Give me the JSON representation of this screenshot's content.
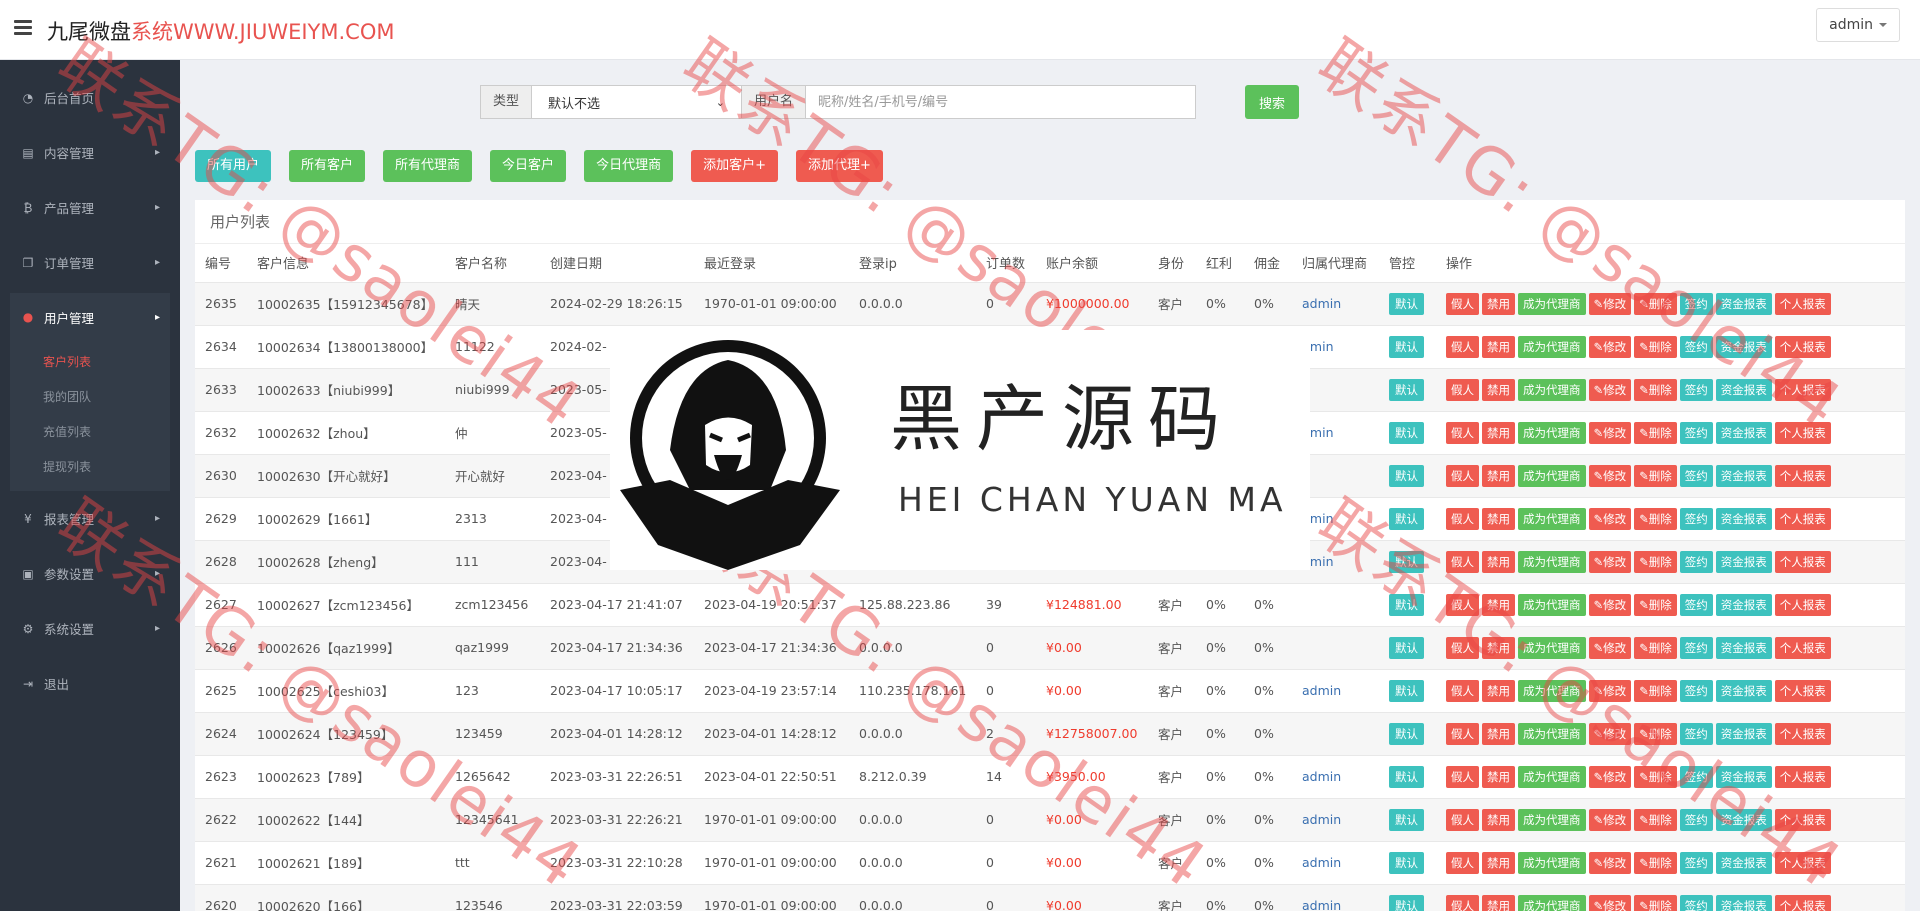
{
  "app": {
    "brand_main": "九尾微盘",
    "brand_accent": "系统WWW.JIUWEIYM.COM",
    "admin_label": "admin"
  },
  "sidebar": {
    "items": [
      {
        "label": "后台首页",
        "icon": "dashboard-icon"
      },
      {
        "label": "内容管理",
        "icon": "book-icon"
      },
      {
        "label": "产品管理",
        "icon": "bitcoin-icon"
      },
      {
        "label": "订单管理",
        "icon": "copy-icon"
      },
      {
        "label": "用户管理",
        "icon": "user-icon"
      },
      {
        "label": "报表管理",
        "icon": "yen-icon"
      },
      {
        "label": "参数设置",
        "icon": "clone-icon"
      },
      {
        "label": "系统设置",
        "icon": "gears-icon"
      },
      {
        "label": "退出",
        "icon": "sign-out-icon"
      }
    ],
    "sub_items": [
      "客户列表",
      "我的团队",
      "充值列表",
      "提现列表"
    ]
  },
  "filter": {
    "type_label": "类型",
    "type_value": "默认不选",
    "user_label": "用户名",
    "user_placeholder": "昵称/姓名/手机号/编号",
    "search_label": "搜索"
  },
  "actions": [
    "所有用户",
    "所有客户",
    "所有代理商",
    "今日客户",
    "今日代理商",
    "添加客户+",
    "添加代理+"
  ],
  "panel_title": "用户列表",
  "table": {
    "headers": [
      "编号",
      "客户信息",
      "客户名称",
      "创建日期",
      "最近登录",
      "登录ip",
      "订单数",
      "账户余额",
      "身份",
      "红利",
      "佣金",
      "归属代理商",
      "管控",
      "操作"
    ],
    "mgmt_label": "默认",
    "ops": [
      "假人",
      "禁用",
      "成为代理商",
      "✎修改",
      "✎删除",
      "签约",
      "资金报表",
      "个人报表"
    ],
    "rows": [
      [
        "2635",
        "10002635【15912345678】",
        "晴天",
        "2024-02-29 18:26:15",
        "1970-01-01 09:00:00",
        "0.0.0.0",
        "0",
        "¥1000000.00",
        "客户",
        "0%",
        "0%",
        "admin"
      ],
      [
        "2634",
        "10002634【13800138000】",
        "11122",
        "2024-02-",
        "",
        "",
        "",
        "",
        "",
        "",
        "",
        "dmin"
      ],
      [
        "2633",
        "10002633【niubi999】",
        "niubi999",
        "2023-05-",
        "",
        "",
        "",
        "",
        "",
        "",
        "",
        ""
      ],
      [
        "2632",
        "10002632【zhou】",
        "仲",
        "2023-05-",
        "",
        "",
        "",
        "",
        "",
        "",
        "",
        "dmin"
      ],
      [
        "2630",
        "10002630【开心就好】",
        "开心就好",
        "2023-04-",
        "",
        "",
        "",
        "",
        "",
        "",
        "",
        ""
      ],
      [
        "2629",
        "10002629【1661】",
        "2313",
        "2023-04-",
        "",
        "",
        "",
        "",
        "",
        "",
        "",
        "dmin"
      ],
      [
        "2628",
        "10002628【zheng】",
        "111",
        "2023-04-",
        "",
        "",
        "",
        "",
        "",
        "",
        "",
        "dmin"
      ],
      [
        "2627",
        "10002627【zcm123456】",
        "zcm123456",
        "2023-04-17 21:41:07",
        "2023-04-19 20:51:37",
        "125.88.223.86",
        "39",
        "¥124881.00",
        "客户",
        "0%",
        "0%",
        ""
      ],
      [
        "2626",
        "10002626【qaz1999】",
        "qaz1999",
        "2023-04-17 21:34:36",
        "2023-04-17 21:34:36",
        "0.0.0.0",
        "0",
        "¥0.00",
        "客户",
        "0%",
        "0%",
        ""
      ],
      [
        "2625",
        "10002625【ceshi03】",
        "123",
        "2023-04-17 10:05:17",
        "2023-04-19 23:57:14",
        "110.235.178.161",
        "0",
        "¥0.00",
        "客户",
        "0%",
        "0%",
        "admin"
      ],
      [
        "2624",
        "10002624【123459】",
        "123459",
        "2023-04-01 14:28:12",
        "2023-04-01 14:28:12",
        "0.0.0.0",
        "2",
        "¥12758007.00",
        "客户",
        "0%",
        "0%",
        ""
      ],
      [
        "2623",
        "10002623【789】",
        "1265642",
        "2023-03-31 22:26:51",
        "2023-04-01 22:50:51",
        "8.212.0.39",
        "14",
        "¥3950.00",
        "客户",
        "0%",
        "0%",
        "admin"
      ],
      [
        "2622",
        "10002622【144】",
        "12345641",
        "2023-03-31 22:26:21",
        "1970-01-01 09:00:00",
        "0.0.0.0",
        "0",
        "¥0.00",
        "客户",
        "0%",
        "0%",
        "admin"
      ],
      [
        "2621",
        "10002621【189】",
        "ttt",
        "2023-03-31 22:10:28",
        "1970-01-01 09:00:00",
        "0.0.0.0",
        "0",
        "¥0.00",
        "客户",
        "0%",
        "0%",
        "admin"
      ],
      [
        "2620",
        "10002620【166】",
        "123546",
        "2023-03-31 22:03:59",
        "1970-01-01 09:00:00",
        "0.0.0.0",
        "0",
        "¥0.00",
        "客户",
        "0%",
        "0%",
        "admin"
      ]
    ]
  },
  "watermark": {
    "contact": "联系TG: @saolei44",
    "logo_cn": "黑产源码",
    "logo_en": "HEI CHAN YUAN MA"
  },
  "colors": {
    "sidebar_bg": "#2b333e",
    "accent_red": "#e8534f",
    "teal": "#3dc2be",
    "green": "#5cc15b",
    "red": "#ef5b50"
  }
}
